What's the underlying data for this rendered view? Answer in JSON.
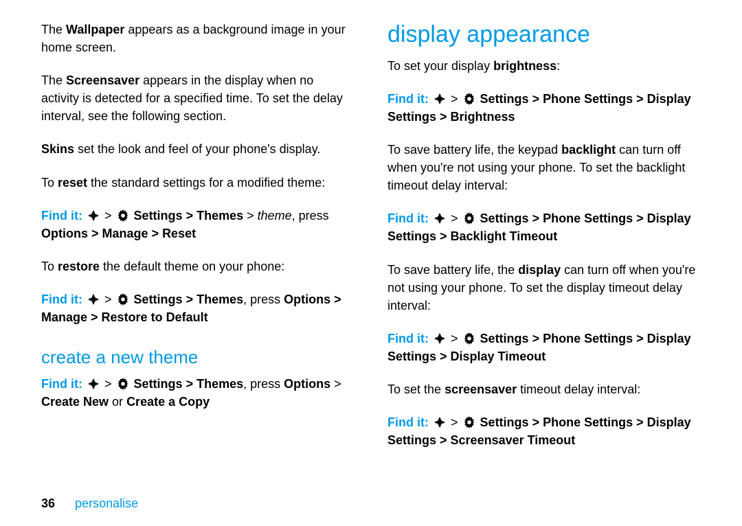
{
  "footer": {
    "page": "36",
    "section": "personalise"
  },
  "left": {
    "p1a": "The ",
    "p1b": "Wallpaper",
    "p1c": " appears as a background image in your home screen.",
    "p2a": "The ",
    "p2b": "Screensaver",
    "p2c": " appears in the display when no activity is detected for a specified time. To set the delay interval, see the following section.",
    "p3a": "Skins",
    "p3b": " set the look and feel of your phone's display.",
    "p4a": "To ",
    "p4b": "reset",
    "p4c": " the standard settings for a modified theme:",
    "find1_label": "Find it:",
    "find1_path1": "Settings",
    "find1_gt1": " > ",
    "find1_path2": "Themes",
    "find1_gt2": " > ",
    "find1_theme": "theme",
    "find1_press": ", press ",
    "find1_opts": "Options",
    "find1_gt3": " > ",
    "find1_manage": "Manage",
    "find1_gt4": " > ",
    "find1_reset": "Reset",
    "p5a": "To ",
    "p5b": "restore",
    "p5c": " the default theme on your phone:",
    "find2_path1": "Settings",
    "find2_path2": "Themes",
    "find2_press": ", press ",
    "find2_opts": "Options",
    "find2_gt": " > ",
    "find2_manage": "Manage",
    "find2_restore": "Restore to Default",
    "h2": "create a new theme",
    "find3_path1": "Settings",
    "find3_path2": "Themes",
    "find3_press": ", press ",
    "find3_opts": "Options",
    "find3_create_new": "Create New",
    "find3_or": " or ",
    "find3_create_copy": "Create a Copy"
  },
  "right": {
    "h1": "display appearance",
    "p1a": "To set your display ",
    "p1b": "brightness",
    "p1c": ":",
    "find_label": "Find it:",
    "gt": " > ",
    "settings": "Settings",
    "phone_settings": "Phone Settings",
    "display_settings": "Display Settings",
    "brightness": "Brightness",
    "p2a": "To save battery life, the keypad ",
    "p2b": "backlight",
    "p2c": " can turn off when you're not using your phone. To set the backlight timeout delay interval:",
    "backlight_timeout": "Backlight Timeout",
    "p3a": "To save battery life, the ",
    "p3b": "display",
    "p3c": " can turn off when you're not using your phone. To set the display timeout delay interval:",
    "display_timeout": "Display Timeout",
    "p4a": "To set the ",
    "p4b": "screensaver",
    "p4c": " timeout delay interval:",
    "screensaver_timeout": "Screensaver Timeout"
  }
}
